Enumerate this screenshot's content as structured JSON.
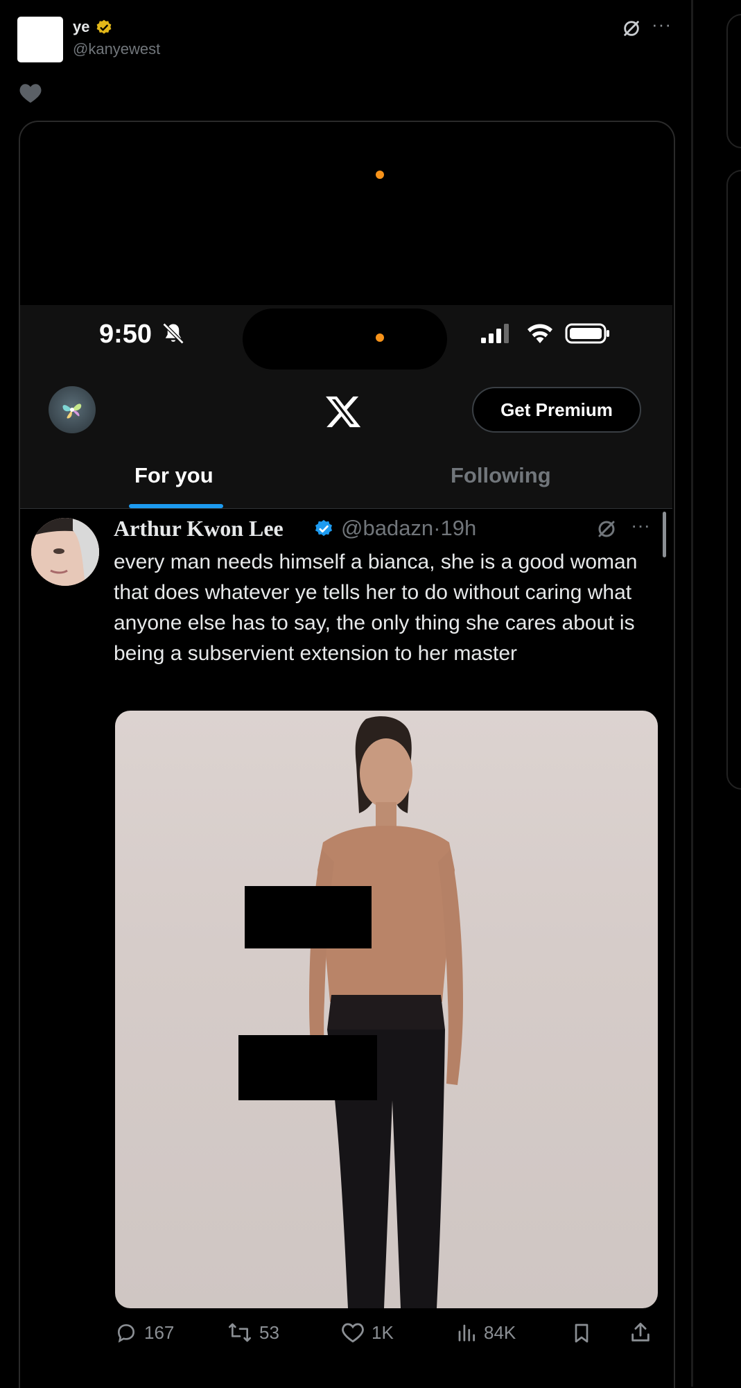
{
  "outer_post": {
    "display_name": "ye",
    "handle": "@kanyewest",
    "badge_icon": "gold-verified-badge-icon",
    "heart_icon": "heart-icon"
  },
  "phone_status": {
    "time": "9:50",
    "icons": [
      "bell-slash-icon",
      "signal-icon",
      "wifi-icon",
      "battery-icon"
    ]
  },
  "app_header": {
    "logo": "x-logo-icon",
    "premium_label": "Get Premium",
    "tabs": [
      {
        "label": "For you",
        "active": true
      },
      {
        "label": "Following",
        "active": false
      }
    ],
    "accent_color": "#1d9bf0"
  },
  "tweet": {
    "author": "Arthur Kwon Lee",
    "handle": "@badazn",
    "separator": "·",
    "time": "19h",
    "text": "every man needs himself a bianca, she is a good woman that does whatever ye tells her to do without caring what anyone else has to say, the only thing she cares about is being a subservient extension to her master",
    "stats": {
      "replies": "167",
      "reposts": "53",
      "likes": "1K",
      "views": "84K"
    }
  }
}
